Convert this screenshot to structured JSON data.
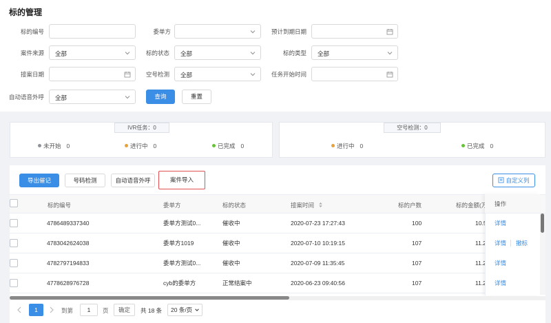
{
  "page": {
    "title": "标的管理"
  },
  "filters": {
    "case_no": {
      "label": "标的编号",
      "value": ""
    },
    "client": {
      "label": "委单方",
      "value": ""
    },
    "expected_date": {
      "label": "预计到期日期",
      "value": ""
    },
    "source": {
      "label": "案件来源",
      "value": "全部"
    },
    "status": {
      "label": "标的状态",
      "value": "全部"
    },
    "type": {
      "label": "标的类型",
      "value": "全部"
    },
    "accept_date": {
      "label": "接案日期",
      "value": ""
    },
    "blank_check": {
      "label": "空号检测",
      "value": "全部"
    },
    "task_start": {
      "label": "任务开始时间",
      "value": ""
    },
    "auto_call": {
      "label": "自动语音外呼",
      "value": "全部"
    },
    "query_label": "查询",
    "reset_label": "重置"
  },
  "ivr": {
    "title": "IVR任务：0",
    "not_started": "未开始",
    "not_started_n": "0",
    "in_progress": "进行中",
    "in_progress_n": "0",
    "done": "已完成",
    "done_n": "0"
  },
  "blank": {
    "title": "空号检测：0",
    "in_progress": "进行中",
    "in_progress_n": "0",
    "done": "已完成",
    "done_n": "0"
  },
  "toolbar": {
    "export": "导出催记",
    "phone_check": "号码检测",
    "auto_call": "自动语音外呼",
    "import": "案件导入",
    "custom_cols": "自定义列"
  },
  "table": {
    "headers": {
      "no": "标的编号",
      "client": "委单方",
      "status": "标的状态",
      "time": "接案时间",
      "households": "标的户数",
      "amount": "标的金额(万",
      "ops": "操作"
    },
    "rows": [
      {
        "no": "4786489337340",
        "client": "委单方测试0...",
        "status": "催收中",
        "time": "2020-07-23 17:27:43",
        "households": "100",
        "amount": "10.5",
        "detail": "详情",
        "revoke": ""
      },
      {
        "no": "4783042624038",
        "client": "委单方1019",
        "status": "催收中",
        "time": "2020-07-10 10:19:15",
        "households": "107",
        "amount": "11.2",
        "detail": "详情",
        "revoke": "撤标"
      },
      {
        "no": "4782797194833",
        "client": "委单方测试0...",
        "status": "催收中",
        "time": "2020-07-09 11:35:45",
        "households": "107",
        "amount": "11.2",
        "detail": "详情",
        "revoke": ""
      },
      {
        "no": "4778628976728",
        "client": "cyb的委单方",
        "status": "正常结案中",
        "time": "2020-06-23 09:40:56",
        "households": "107",
        "amount": "11.2",
        "detail": "详情",
        "revoke": ""
      }
    ]
  },
  "pagination": {
    "current": "1",
    "goto_label": "到第",
    "goto_value": "1",
    "page_unit": "页",
    "confirm": "确定",
    "total": "共 18 条",
    "page_size": "20 条/页"
  },
  "colors": {
    "primary": "#3a8ee6",
    "green": "#67c23a",
    "orange": "#e6a23c",
    "grey": "#909399",
    "highlight": "#e05050"
  }
}
